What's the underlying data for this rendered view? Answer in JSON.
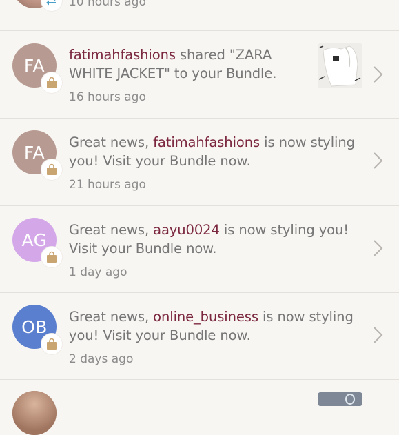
{
  "notifications": [
    {
      "time": "10 hours ago"
    },
    {
      "avatar_initials": "FA",
      "avatar_color": "#b79a91",
      "username": "fatimahfashions",
      "text_after": " shared \"ZARA WHITE JACKET\" to your Bundle.",
      "time": "16 hours ago"
    },
    {
      "avatar_initials": "FA",
      "avatar_color": "#b79a91",
      "text_before": "Great news, ",
      "username": "fatimahfashions",
      "text_after": " is now styling you! Visit your Bundle now.",
      "time": "21 hours ago"
    },
    {
      "avatar_initials": "AG",
      "avatar_color": "#d4a8e8",
      "text_before": "Great news, ",
      "username": "aayu0024",
      "text_after": " is now styling you! Visit your Bundle now.",
      "time": "1 day ago"
    },
    {
      "avatar_initials": "OB",
      "avatar_color": "#5a7fcf",
      "text_before": "Great news, ",
      "username": "online_business",
      "text_after": " is now styling you! Visit your Bundle now.",
      "time": "2 days ago"
    }
  ],
  "icons": {
    "repost": "repost-icon",
    "bundle": "shopping-bag-icon",
    "chevron": "chevron-right-icon"
  },
  "colors": {
    "accent": "#7b2740",
    "bag": "#c9a571",
    "repost": "#4aa0c9"
  }
}
